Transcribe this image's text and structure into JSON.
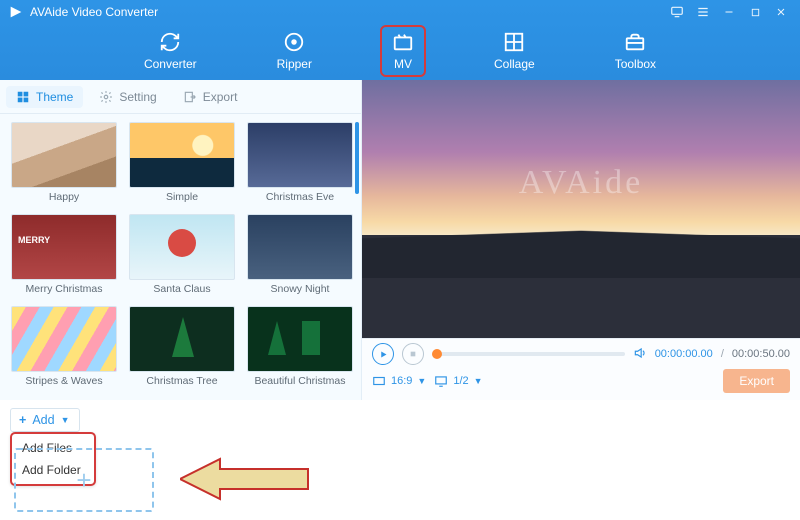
{
  "app": {
    "title": "AVAide Video Converter",
    "watermark": "AVAide"
  },
  "nav": {
    "converter": "Converter",
    "ripper": "Ripper",
    "mv": "MV",
    "collage": "Collage",
    "toolbox": "Toolbox"
  },
  "left_tabs": {
    "theme": "Theme",
    "setting": "Setting",
    "export": "Export"
  },
  "themes": {
    "happy": "Happy",
    "simple": "Simple",
    "xmas_eve": "Christmas Eve",
    "merry": "Merry Christmas",
    "santa": "Santa Claus",
    "snowy": "Snowy Night",
    "stripes": "Stripes & Waves",
    "xmas_tree": "Christmas Tree",
    "beautiful": "Beautiful Christmas"
  },
  "player": {
    "current_time": "00:00:00.00",
    "total_time": "00:00:50.00",
    "aspect": "16:9",
    "page": "1/2",
    "export_label": "Export"
  },
  "add": {
    "button": "Add",
    "files": "Add Files",
    "folder": "Add Folder"
  }
}
